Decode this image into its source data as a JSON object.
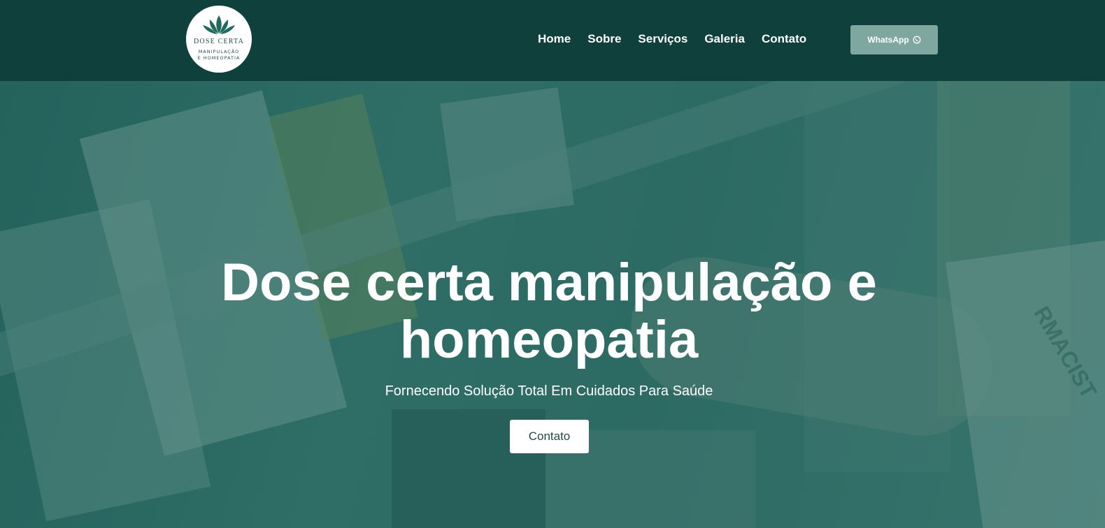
{
  "header": {
    "logo": {
      "title": "DOSE CERTA",
      "sub_line1": "MANIPULAÇÃO",
      "sub_line2": "E HOMEOPATIA"
    },
    "nav": [
      "Home",
      "Sobre",
      "Serviços",
      "Galeria",
      "Contato"
    ],
    "whatsapp_label": "WhatsApp"
  },
  "hero": {
    "title": "Dose certa manipulação e homeopatia",
    "subtitle": "Fornecendo Solução Total Em Cuidados Para Saúde",
    "button_label": "Contato",
    "background_text": "RMACIST"
  },
  "colors": {
    "header_bg": "#0f403c",
    "whatsapp_button": "#7ea89f",
    "hero_tint": "#3b7d76",
    "logo_leaf": "#1f6b5e"
  },
  "icons": {
    "whatsapp": "whatsapp-icon",
    "logo_leaf": "lotus-leaf-icon"
  }
}
